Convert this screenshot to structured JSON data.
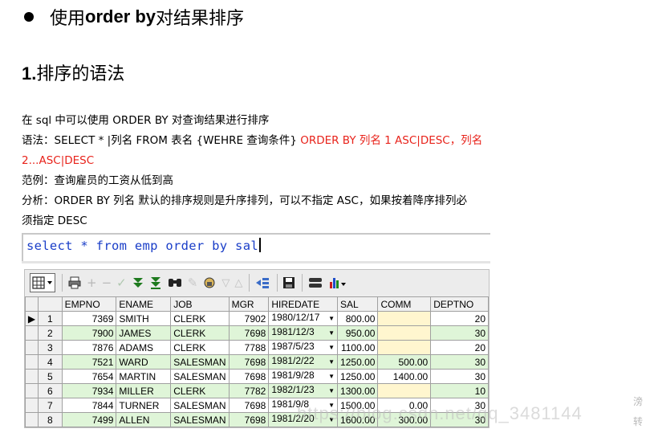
{
  "heading": {
    "prefix": "使用 ",
    "keyword": "order by",
    "suffix": " 对结果排序"
  },
  "subheading": {
    "number": "1.",
    "text": "排序的语法"
  },
  "paragraphs": {
    "intro": "在 sql 中可以使用 ORDER BY 对查询结果进行排序",
    "syntax_black": "语法：SELECT  *  |列名  FROM  表名 {WEHRE  查询条件} ",
    "syntax_red_1": "ORDER  BY  列名 1  ASC|DESC，列名",
    "syntax_red_2": "2...ASC|DESC",
    "example": "范例：查询雇员的工资从低到高",
    "analysis_1": "分析：ORDER BY  列名  默认的排序规则是升序排列，可以不指定 ASC，如果按着降序排列必",
    "analysis_2": "须指定 DESC"
  },
  "sql": {
    "query": "select * from emp order by sal"
  },
  "grid": {
    "columns": [
      "EMPNO",
      "ENAME",
      "JOB",
      "MGR",
      "HIREDATE",
      "SAL",
      "COMM",
      "DEPTNO"
    ],
    "rows": [
      {
        "rn": "1",
        "empno": "7369",
        "ename": "SMITH",
        "job": "CLERK",
        "mgr": "7902",
        "hiredate": "1980/12/17",
        "sal": "800.00",
        "comm": "",
        "deptno": "20"
      },
      {
        "rn": "2",
        "empno": "7900",
        "ename": "JAMES",
        "job": "CLERK",
        "mgr": "7698",
        "hiredate": "1981/12/3",
        "sal": "950.00",
        "comm": "",
        "deptno": "30"
      },
      {
        "rn": "3",
        "empno": "7876",
        "ename": "ADAMS",
        "job": "CLERK",
        "mgr": "7788",
        "hiredate": "1987/5/23",
        "sal": "1100.00",
        "comm": "",
        "deptno": "20"
      },
      {
        "rn": "4",
        "empno": "7521",
        "ename": "WARD",
        "job": "SALESMAN",
        "mgr": "7698",
        "hiredate": "1981/2/22",
        "sal": "1250.00",
        "comm": "500.00",
        "deptno": "30"
      },
      {
        "rn": "5",
        "empno": "7654",
        "ename": "MARTIN",
        "job": "SALESMAN",
        "mgr": "7698",
        "hiredate": "1981/9/28",
        "sal": "1250.00",
        "comm": "1400.00",
        "deptno": "30"
      },
      {
        "rn": "6",
        "empno": "7934",
        "ename": "MILLER",
        "job": "CLERK",
        "mgr": "7782",
        "hiredate": "1982/1/23",
        "sal": "1300.00",
        "comm": "",
        "deptno": "10"
      },
      {
        "rn": "7",
        "empno": "7844",
        "ename": "TURNER",
        "job": "SALESMAN",
        "mgr": "7698",
        "hiredate": "1981/9/8",
        "sal": "1500.00",
        "comm": "0.00",
        "deptno": "30"
      },
      {
        "rn": "8",
        "empno": "7499",
        "ename": "ALLEN",
        "job": "SALESMAN",
        "mgr": "7698",
        "hiredate": "1981/2/20",
        "sal": "1600.00",
        "comm": "300.00",
        "deptno": "30"
      }
    ]
  },
  "watermark": {
    "text": "https://blog.csdn.net/qq_3481144",
    "side_1": "滂",
    "side_2": "转"
  },
  "colors": {
    "accent_red": "#e8231b",
    "sql_blue": "#1a3ec8",
    "row_green": "#dff5d8",
    "null_yellow": "#fff6cf"
  },
  "icons": [
    "grid-view-icon",
    "print-icon",
    "add-row-icon",
    "delete-row-icon",
    "post-icon",
    "fetch-next-icon",
    "fetch-last-icon",
    "find-icon",
    "clear-icon",
    "lock-icon",
    "filter-icon",
    "sort-asc-icon",
    "sort-desc-icon",
    "export-icon",
    "save-icon",
    "query-by-example-icon",
    "chart-icon"
  ]
}
